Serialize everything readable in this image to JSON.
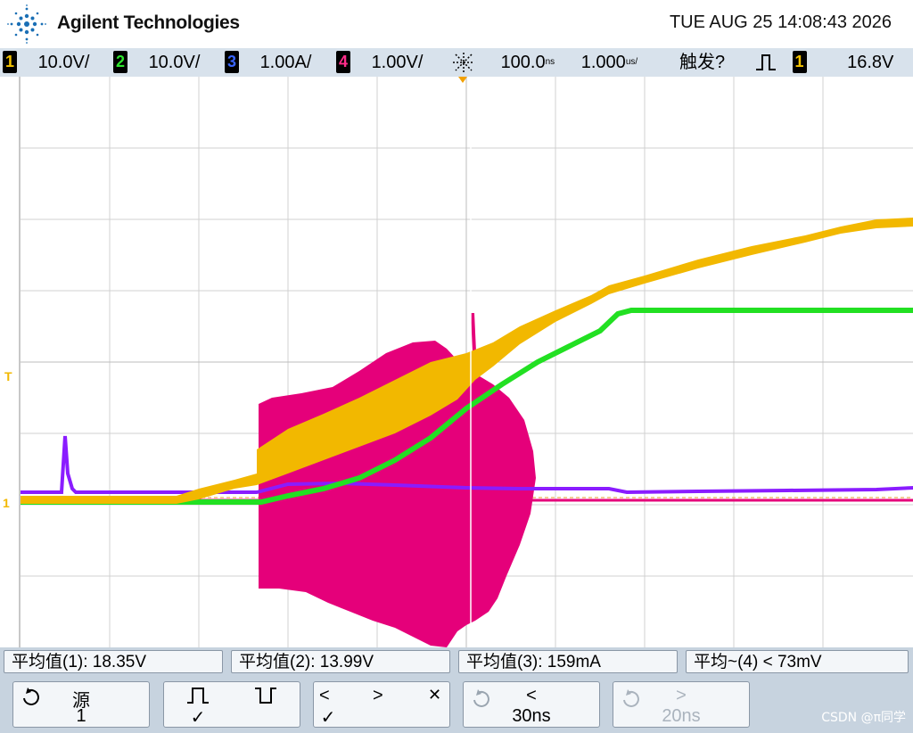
{
  "header": {
    "brand": "Agilent Technologies",
    "datetime": "TUE AUG 25 14:08:43 2026"
  },
  "status": {
    "channels": [
      {
        "num": "1",
        "scale": "10.0V/",
        "color": "#f5c400"
      },
      {
        "num": "2",
        "scale": "10.0V/",
        "color": "#2ee52e"
      },
      {
        "num": "3",
        "scale": "1.00A/",
        "color": "#3a66ff"
      },
      {
        "num": "4",
        "scale": "1.00V/",
        "color": "#ff2d8a"
      }
    ],
    "time_ref": "100.0",
    "time_ref_unit": "ns",
    "time_scale": "1.000",
    "time_scale_unit": "us/",
    "trigger_state": "触发?",
    "trigger_source": "1",
    "trigger_level": "16.8V",
    "icons": [
      "time-reference-icon",
      "trigger-edge-icon"
    ]
  },
  "markers": {
    "trigger": "T",
    "ground": "1"
  },
  "measurements": [
    {
      "label": "平均值(1): 18.35V"
    },
    {
      "label": "平均值(2): 13.99V"
    },
    {
      "label": "平均值(3): 159mA"
    },
    {
      "label": "平均~(4) < 73mV"
    }
  ],
  "softkeys": [
    {
      "top": "源",
      "bottom": "1",
      "icon": "rotate-knob-icon"
    },
    {
      "top": "",
      "bottom": "✓",
      "icon": "rising-edge-icon"
    },
    {
      "top": "",
      "bottom": "✓",
      "icon": "falling-edge-icon"
    },
    {
      "top": "",
      "bottom": "✓",
      "icon": "arrows-icon"
    },
    {
      "top": "<",
      "bottom": "30ns",
      "icon": "rotate-knob-icon"
    },
    {
      "top": ">",
      "bottom": "20ns",
      "icon": "rotate-knob-icon",
      "disabled": true
    }
  ],
  "softkey_glyphs": {
    "lt": "<",
    "gt": ">",
    "x": "✕"
  },
  "watermark": "CSDN @π同学",
  "colors": {
    "ch1": "#f2b800",
    "ch2": "#22e022",
    "ch3": "#8a1cff",
    "ch4": "#e5007a",
    "grid": "#d0d0d0",
    "bar": "#d8e2ec"
  }
}
